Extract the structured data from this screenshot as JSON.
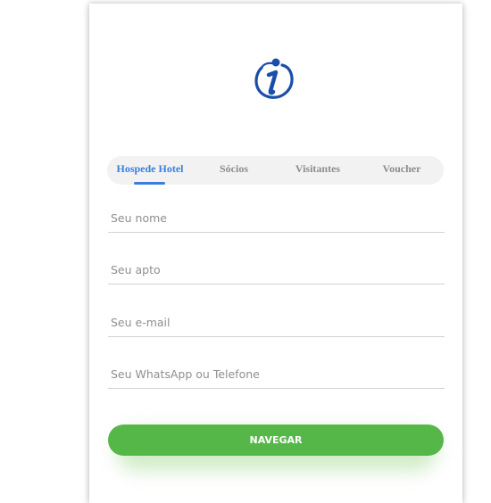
{
  "brand": {
    "logo_icon": "info-i-icon",
    "logo_color": "#1a4ea8"
  },
  "tabs": [
    {
      "label": "Hospede Hotel",
      "active": true
    },
    {
      "label": "Sócios",
      "active": false
    },
    {
      "label": "Visitantes",
      "active": false
    },
    {
      "label": "Voucher",
      "active": false
    }
  ],
  "form": {
    "name_placeholder": "Seu nome",
    "apto_placeholder": "Seu apto",
    "email_placeholder": "Seu e-mail",
    "phone_placeholder": "Seu WhatsApp ou Telefone"
  },
  "submit_label": "NAVEGAR",
  "colors": {
    "accent": "#3c7ee0",
    "button": "#55b748",
    "tab_bg": "#f2f2f2",
    "inactive_tab": "#8c8c8c"
  }
}
